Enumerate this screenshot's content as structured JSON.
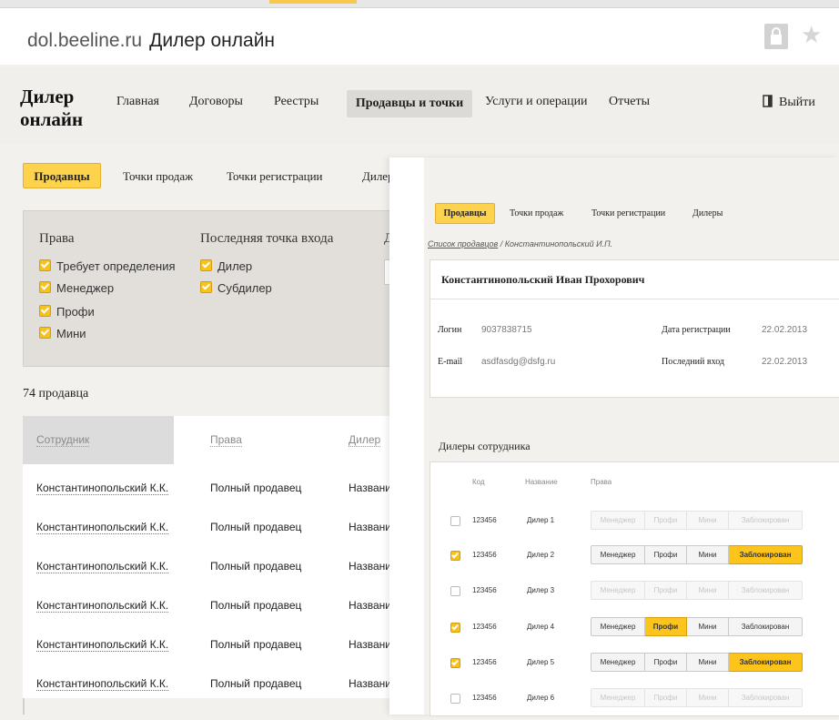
{
  "browser": {
    "domain": "dol.beeline.ru",
    "title": "Дилер онлайн",
    "icons": {
      "lock": "lock-icon",
      "star": "star-icon"
    }
  },
  "header": {
    "logo_line1": "Дилер",
    "logo_line2": "онлайн",
    "nav": [
      "Главная",
      "Договоры",
      "Реестры",
      "Продавцы и точки",
      "Услуги и операции",
      "Отчеты"
    ],
    "logout": "Выйти"
  },
  "subtabs": [
    "Продавцы",
    "Точки продаж",
    "Точки регистрации",
    "Дилеры"
  ],
  "filter": {
    "rights_title": "Права",
    "rights": [
      "Требует определения",
      "Менеджер",
      "Профи",
      "Мини"
    ],
    "last_point_title": "Последняя точка входа",
    "last_points": [
      "Дилер",
      "Субдилер"
    ],
    "third_title_fragment": "Д"
  },
  "count": "74 продавца",
  "sellers_table": {
    "headers": [
      "Сотрудник",
      "Права",
      "Дилер"
    ],
    "rows": [
      {
        "name": "Константинопольский К.К.",
        "rights": "Полный продавец",
        "dealer": "Названи"
      },
      {
        "name": "Константинопольский К.К.",
        "rights": "Полный продавец",
        "dealer": "Названи"
      },
      {
        "name": "Константинопольский К.К.",
        "rights": "Полный продавец",
        "dealer": "Названи"
      },
      {
        "name": "Константинопольский К.К.",
        "rights": "Полный продавец",
        "dealer": "Названи"
      },
      {
        "name": "Константинопольский К.К.",
        "rights": "Полный продавец",
        "dealer": "Названи"
      },
      {
        "name": "Константинопольский К.К.",
        "rights": "Полный продавец",
        "dealer": "Названи"
      }
    ]
  },
  "overlay": {
    "tabs": [
      "Продавцы",
      "Точки продаж",
      "Точки регистрации",
      "Дилеры"
    ],
    "breadcrumb_link": "Список продавцов",
    "breadcrumb_sep": " / ",
    "breadcrumb_current": "Константинопольский И.П.",
    "employee_name": "Константинопольский Иван Прохорович",
    "login_label": "Логин",
    "login_value": "9037838715",
    "email_label": "E-mail",
    "email_value": "asdfasdg@dsfg.ru",
    "reg_date_label": "Дата регистрации",
    "reg_date_value": "22.02.2013",
    "last_login_label": "Последний вход",
    "last_login_value": "22.02.2013",
    "dealers_title": "Дилеры сотрудника",
    "dealers_headers": [
      "Код",
      "Название",
      "Права"
    ],
    "role_labels": [
      "Менеджер",
      "Профи",
      "Мини",
      "Заблокирован"
    ],
    "dealers": [
      {
        "checked": false,
        "code": "123456",
        "name": "Дилер 1",
        "active": null
      },
      {
        "checked": true,
        "code": "123456",
        "name": "Дилер 2",
        "active": 3
      },
      {
        "checked": false,
        "code": "123456",
        "name": "Дилер 3",
        "active": null
      },
      {
        "checked": true,
        "code": "123456",
        "name": "Дилер 4",
        "active": 1
      },
      {
        "checked": true,
        "code": "123456",
        "name": "Дилер 5",
        "active": 3
      },
      {
        "checked": false,
        "code": "123456",
        "name": "Дилер 6",
        "active": null
      }
    ]
  },
  "colors": {
    "accent": "#fdd24c",
    "accent_border": "#e5b12a",
    "page_bg": "#f3f1ed"
  }
}
